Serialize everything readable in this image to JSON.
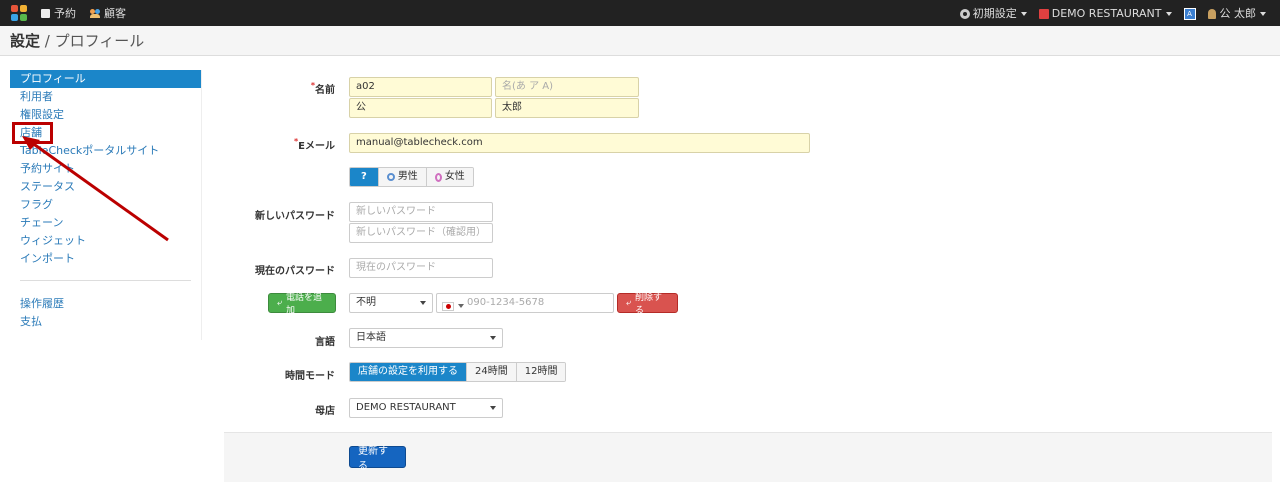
{
  "topbar": {
    "nav": [
      {
        "label": "予約",
        "icon": "book-icon"
      },
      {
        "label": "顧客",
        "icon": "users-icon"
      }
    ],
    "settings_label": "初期設定",
    "restaurant_label": "DEMO RESTAURANT",
    "translate_icon_text": "A",
    "user_label": "公 太郎"
  },
  "header": {
    "section": "設定",
    "separator": " / ",
    "page": "プロフィール"
  },
  "sidebar": {
    "items": [
      {
        "label": "プロフィール",
        "active": true
      },
      {
        "label": "利用者"
      },
      {
        "label": "権限設定"
      },
      {
        "label": "店舗"
      },
      {
        "label": "TableCheckポータルサイト"
      },
      {
        "label": "予約サイト"
      },
      {
        "label": "ステータス"
      },
      {
        "label": "フラグ"
      },
      {
        "label": "チェーン"
      },
      {
        "label": "ウィジェット"
      },
      {
        "label": "インポート"
      }
    ],
    "items2": [
      {
        "label": "操作履歴"
      },
      {
        "label": "支払"
      }
    ]
  },
  "form": {
    "name_label": "名前",
    "required_mark": "*",
    "name_first_kana": "a02",
    "name_last_kana_placeholder": "名(あ ア A)",
    "name_last": "公",
    "name_first": "太郎",
    "email_label": "Eメール",
    "email_value": "manual@tablecheck.com",
    "gender_options": [
      "?",
      "男性",
      "女性"
    ],
    "new_password_label": "新しいパスワード",
    "new_password_placeholder": "新しいパスワード",
    "new_password_confirm_placeholder": "新しいパスワード（確認用）",
    "current_password_label": "現在のパスワード",
    "current_password_placeholder": "現在のパスワード",
    "add_phone_label": "電話を追加",
    "phone_type": "不明",
    "phone_placeholder": "090-1234-5678",
    "delete_label": "削除する",
    "language_label": "言語",
    "language_value": "日本語",
    "time_mode_label": "時間モード",
    "time_mode_options": [
      "店舗の設定を利用する",
      "24時間",
      "12時間"
    ],
    "home_store_label": "母店",
    "home_store_value": "DEMO RESTAURANT",
    "submit_label": "更新する"
  }
}
